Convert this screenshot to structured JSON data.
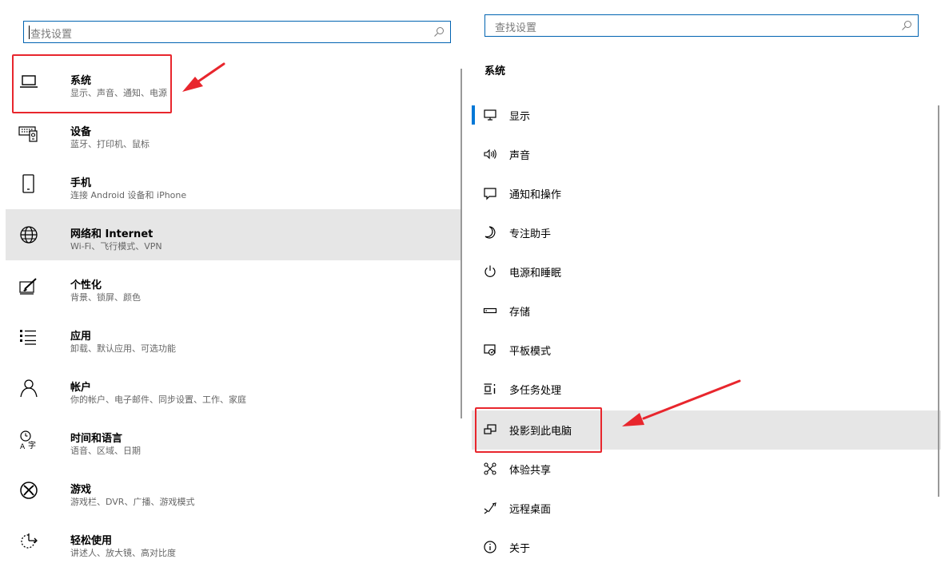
{
  "left": {
    "search": {
      "placeholder": "查找设置"
    },
    "categories": [
      {
        "title": "系统",
        "desc": "显示、声音、通知、电源",
        "icon": "laptop-icon"
      },
      {
        "title": "设备",
        "desc": "蓝牙、打印机、鼠标",
        "icon": "keyboard-icon"
      },
      {
        "title": "手机",
        "desc": "连接 Android 设备和 iPhone",
        "icon": "phone-icon"
      },
      {
        "title": "网络和 Internet",
        "desc": "Wi-Fi、飞行模式、VPN",
        "icon": "globe-icon"
      },
      {
        "title": "个性化",
        "desc": "背景、锁屏、颜色",
        "icon": "brush-icon"
      },
      {
        "title": "应用",
        "desc": "卸载、默认应用、可选功能",
        "icon": "apps-list-icon"
      },
      {
        "title": "帐户",
        "desc": "你的帐户、电子邮件、同步设置、工作、家庭",
        "icon": "person-icon"
      },
      {
        "title": "时间和语言",
        "desc": "语音、区域、日期",
        "icon": "time-language-icon"
      },
      {
        "title": "游戏",
        "desc": "游戏栏、DVR、广播、游戏模式",
        "icon": "xbox-icon"
      },
      {
        "title": "轻松使用",
        "desc": "讲述人、放大镜、高对比度",
        "icon": "ease-of-access-icon"
      }
    ]
  },
  "right": {
    "search": {
      "placeholder": "查找设置"
    },
    "section_title": "系统",
    "nav": [
      {
        "label": "显示",
        "icon": "monitor-icon"
      },
      {
        "label": "声音",
        "icon": "speaker-icon"
      },
      {
        "label": "通知和操作",
        "icon": "notification-icon"
      },
      {
        "label": "专注助手",
        "icon": "moon-icon"
      },
      {
        "label": "电源和睡眠",
        "icon": "power-icon"
      },
      {
        "label": "存储",
        "icon": "storage-icon"
      },
      {
        "label": "平板模式",
        "icon": "tablet-mode-icon"
      },
      {
        "label": "多任务处理",
        "icon": "multitask-icon"
      },
      {
        "label": "投影到此电脑",
        "icon": "project-icon"
      },
      {
        "label": "体验共享",
        "icon": "share-icon"
      },
      {
        "label": "远程桌面",
        "icon": "remote-desktop-icon"
      },
      {
        "label": "关于",
        "icon": "info-icon"
      }
    ]
  },
  "colors": {
    "accent": "#0078d7",
    "annotation_red": "#e8262d",
    "hover_bg": "#e6e6e6",
    "secondary_text": "#666666"
  }
}
